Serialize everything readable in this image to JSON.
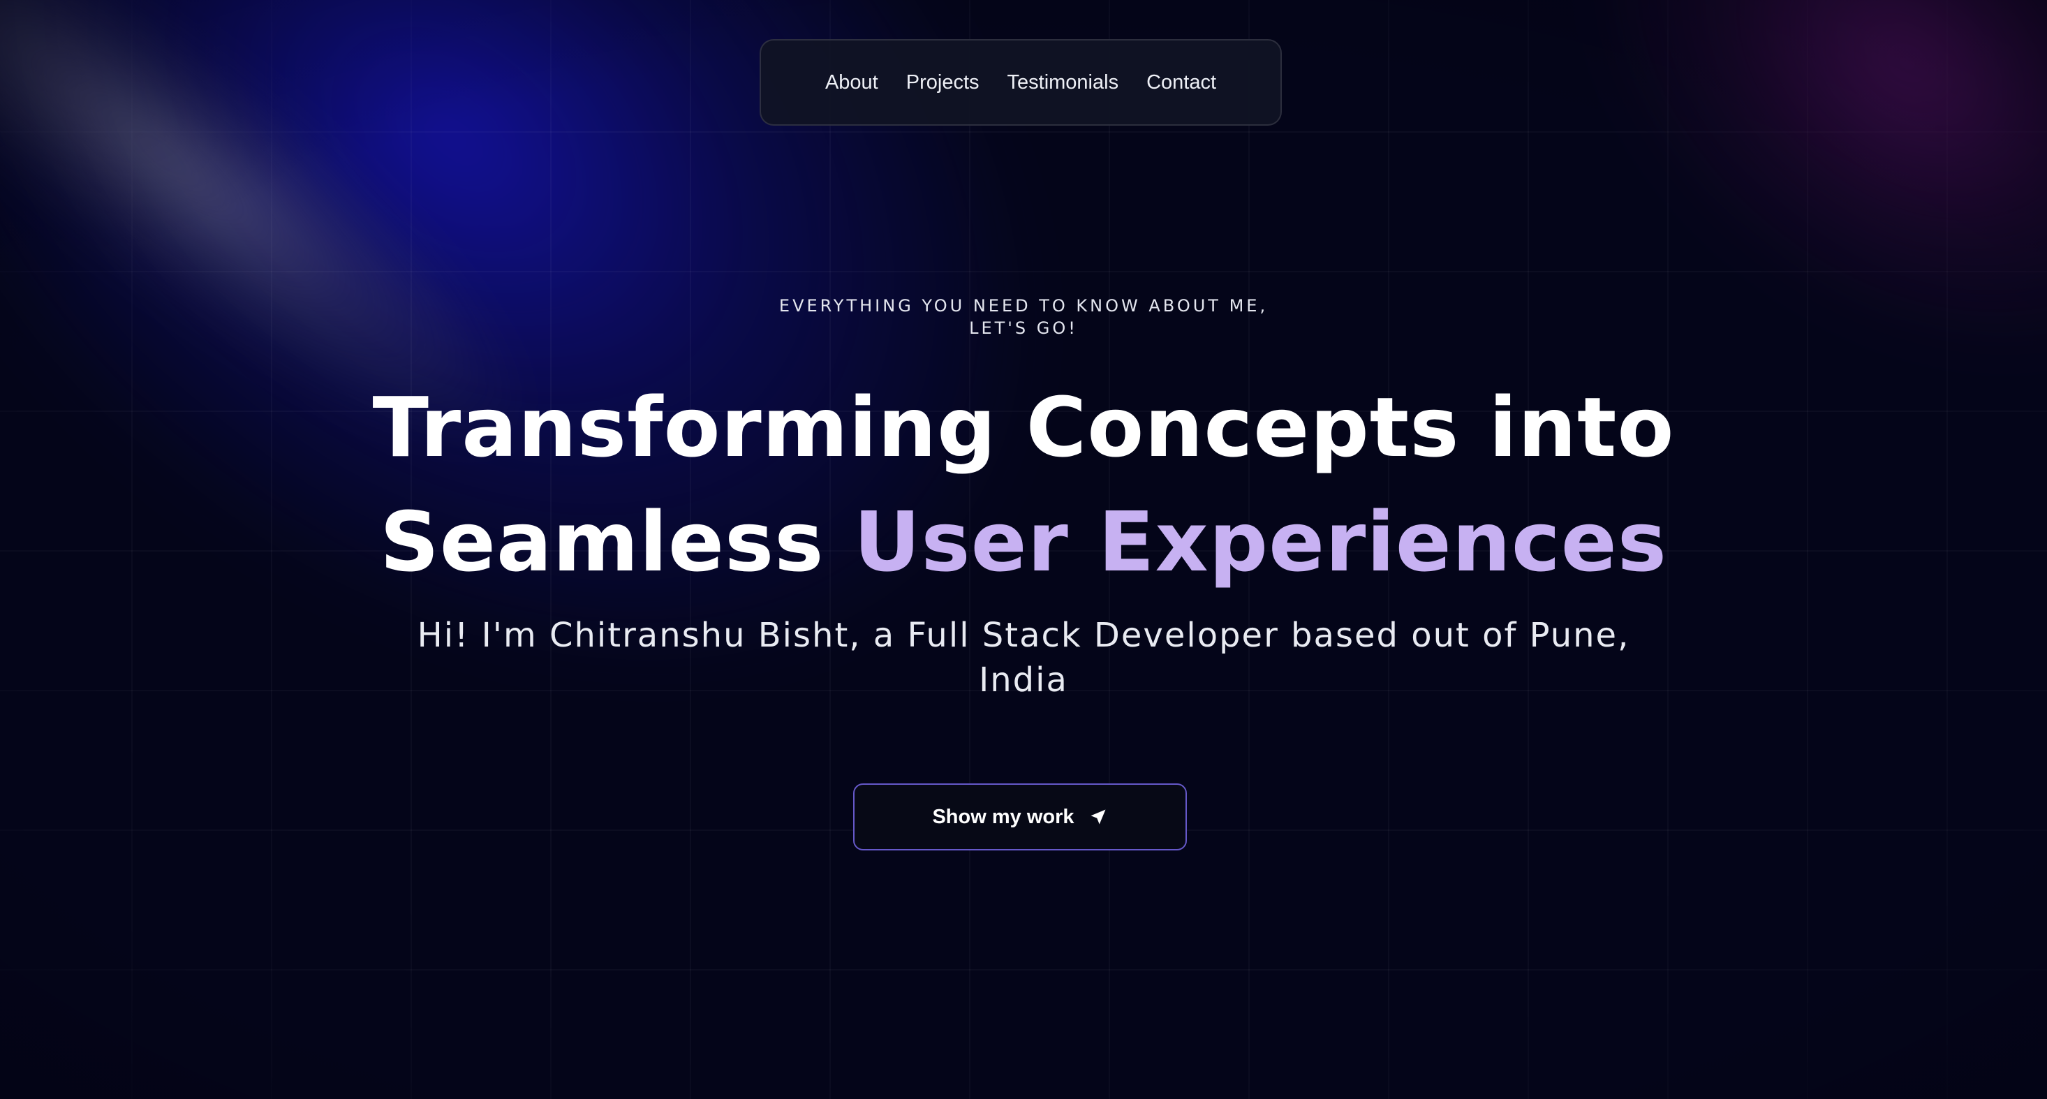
{
  "nav": {
    "items": [
      {
        "label": "About"
      },
      {
        "label": "Projects"
      },
      {
        "label": "Testimonials"
      },
      {
        "label": "Contact"
      }
    ]
  },
  "hero": {
    "eyebrow_line1": "EVERYTHING YOU NEED TO KNOW ABOUT ME,",
    "eyebrow_line2": "LET'S GO!",
    "headline_line1": "Transforming Concepts into",
    "headline_line2_plain": "Seamless",
    "headline_line2_accent": "User Experiences",
    "intro_line1": "Hi! I'm Chitranshu Bisht, a Full Stack Developer based out of Pune,",
    "intro_line2": "India",
    "cta_label": "Show my work",
    "cta_icon": "navigation-arrow-icon"
  },
  "colors": {
    "background": "#040519",
    "accent_text": "#c7b1f2",
    "button_border": "#6558c8",
    "nav_background": "#101324"
  }
}
